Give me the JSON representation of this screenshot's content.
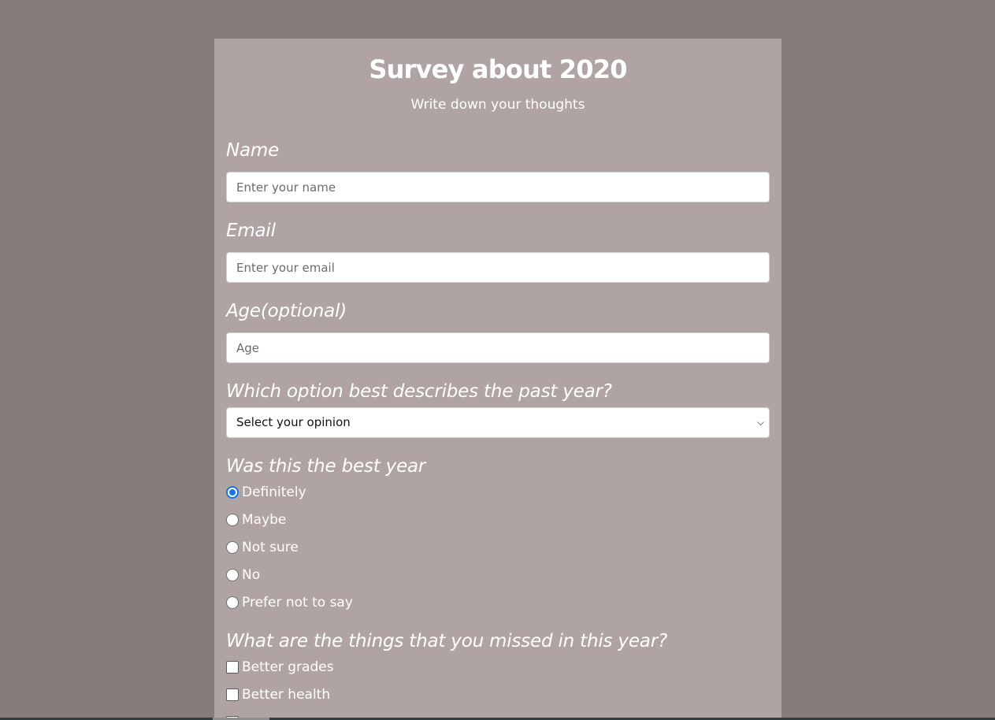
{
  "survey": {
    "title": "Survey about 2020",
    "subtitle": "Write down your thoughts",
    "name": {
      "label": "Name",
      "placeholder": "Enter your name"
    },
    "email": {
      "label": "Email",
      "placeholder": "Enter your email"
    },
    "age": {
      "label": "Age(optional)",
      "placeholder": "Age"
    },
    "dropdown": {
      "label": "Which option best describes the past year?",
      "selected": "Select your opinion"
    },
    "best_year": {
      "label": "Was this the best year",
      "selected_index": 0,
      "options": [
        "Definitely",
        "Maybe",
        "Not sure",
        "No",
        "Prefer not to say"
      ]
    },
    "missed": {
      "label": "What are the things that you missed in this year?",
      "options": [
        "Better grades",
        "Better health"
      ]
    }
  }
}
